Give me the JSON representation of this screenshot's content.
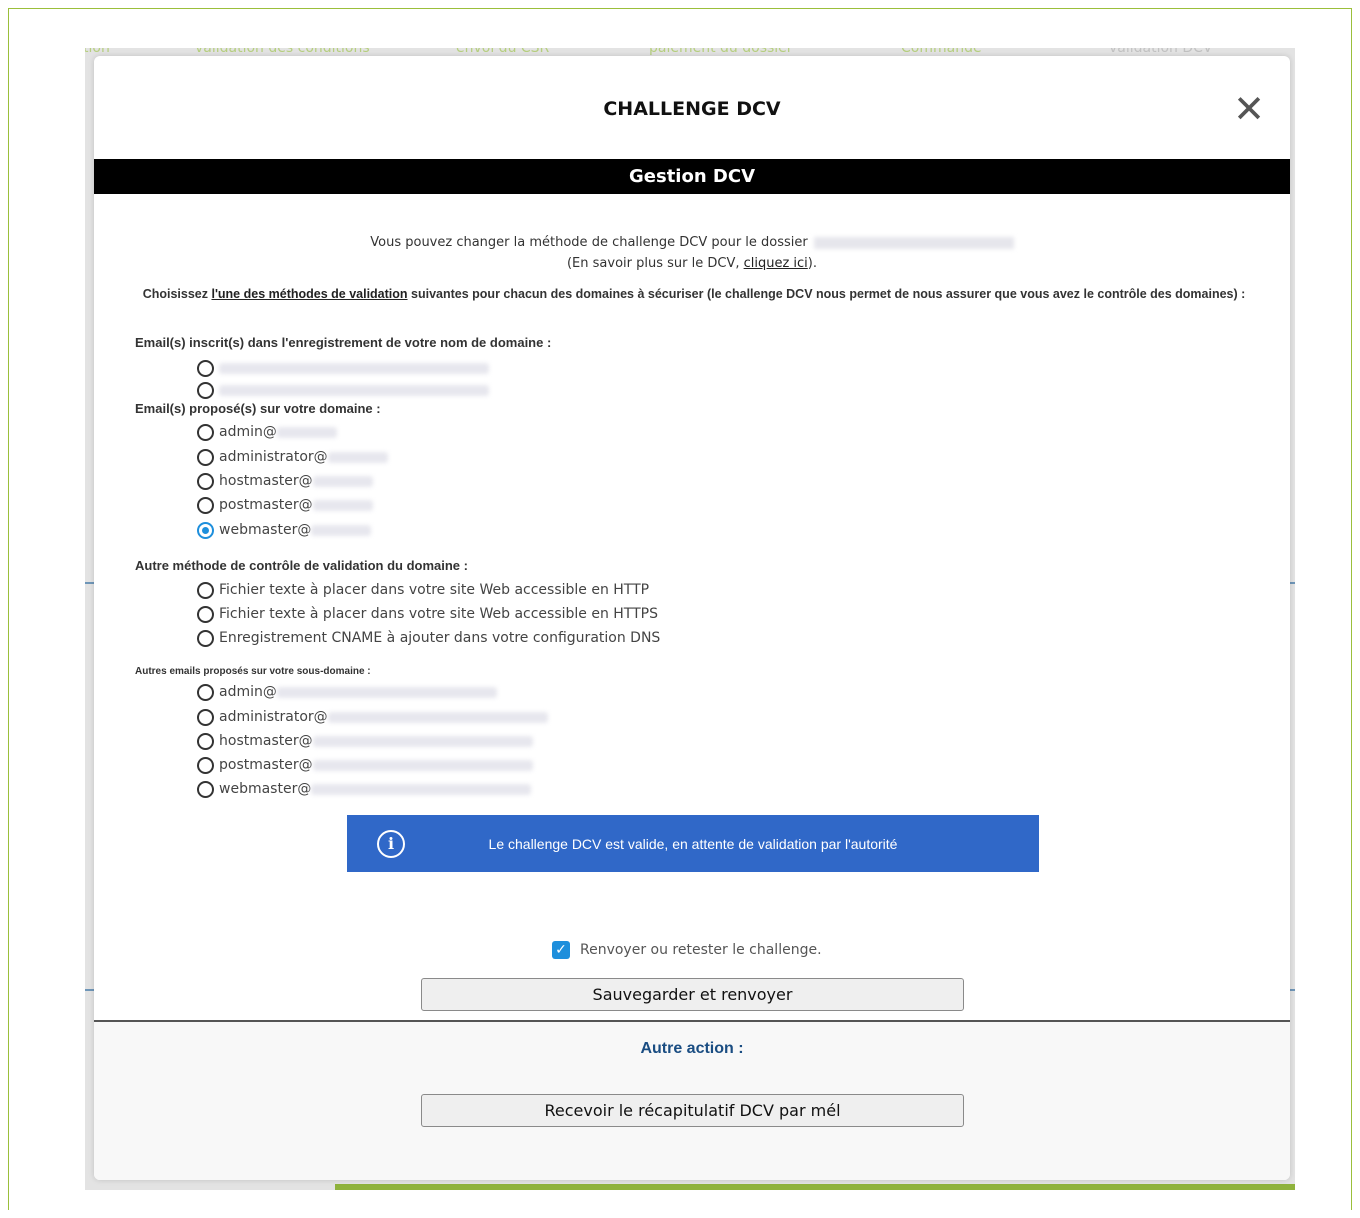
{
  "background": {
    "steps": [
      "tion",
      "validation des conditions",
      "envoi du CSR",
      "paiement du dossier",
      "Commande",
      "validation DCV"
    ]
  },
  "modal": {
    "title": "CHALLENGE DCV",
    "close_label": "✕",
    "section_bar": "Gestion DCV",
    "intro_line1": "Vous pouvez changer la méthode de challenge DCV pour le dossier",
    "intro_line2_prefix": "(En savoir plus sur le DCV, ",
    "intro_link": "cliquez ici",
    "intro_line2_suffix": ").",
    "choose_prefix": "Choisissez ",
    "choose_link": "l'une des méthodes de validation",
    "choose_suffix": " suivantes pour chacun des domaines à sécuriser (le challenge DCV nous permet de nous assurer que vous avez le contrôle des domaines) :",
    "registrant_heading": "Email(s) inscrit(s) dans l'enregistrement de votre nom de domaine :",
    "proposed_heading": "Email(s) proposé(s) sur votre domaine :",
    "proposed_options": [
      "admin@",
      "administrator@",
      "hostmaster@",
      "postmaster@",
      "webmaster@"
    ],
    "selected_option": "webmaster@",
    "other_heading": "Autre méthode de contrôle de validation du domaine :",
    "other_options": [
      "Fichier texte à placer dans votre site Web accessible en HTTP",
      "Fichier texte à placer dans votre site Web accessible en HTTPS",
      "Enregistrement CNAME à ajouter dans votre configuration DNS"
    ],
    "subdomain_heading": "Autres emails proposés sur votre sous-domaine :",
    "subdomain_options": [
      "admin@",
      "administrator@",
      "hostmaster@",
      "postmaster@",
      "webmaster@"
    ],
    "info_message": "Le challenge DCV est valide, en attente de validation par l'autorité",
    "resend_checkbox_label": "Renvoyer ou retester le challenge.",
    "resend_checked": true,
    "save_button": "Sauvegarder et renvoyer",
    "other_action_heading": "Autre action :",
    "recap_button": "Recevoir le récapitulatif DCV par mél"
  },
  "colors": {
    "accent_blue": "#1e8fdc",
    "info_bg": "#3068c8",
    "other_action_text": "#1a4d82"
  }
}
